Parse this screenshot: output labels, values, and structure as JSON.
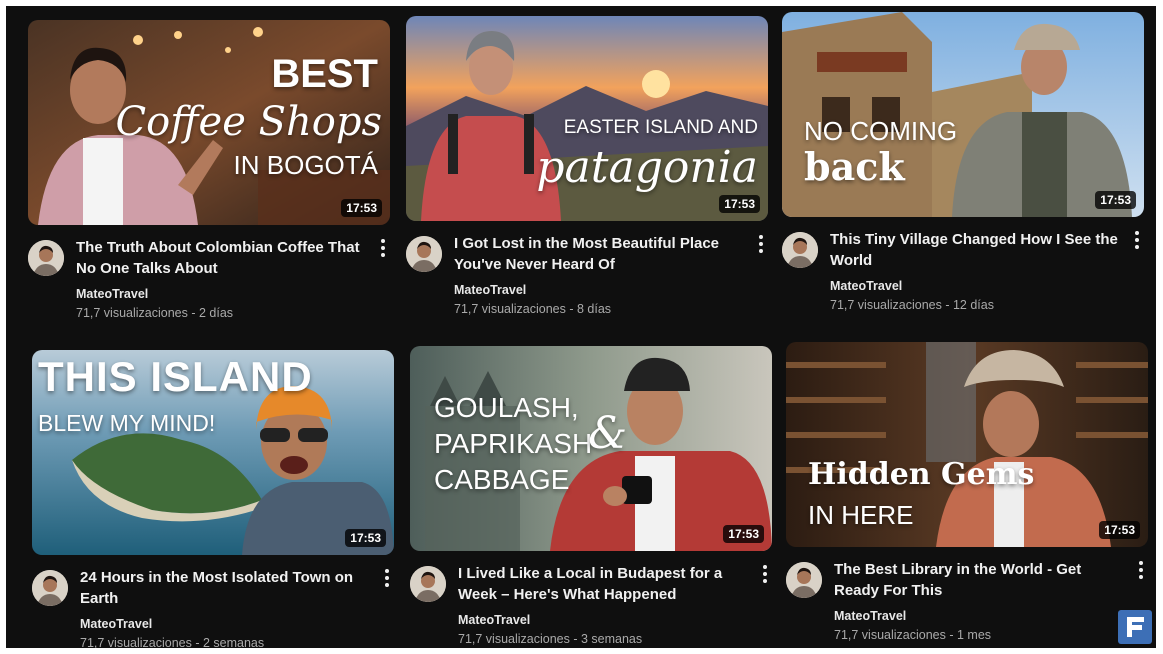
{
  "videos": [
    {
      "title": "The Truth About Colombian Coffee That No One Talks About",
      "channel": "MateoTravel",
      "stats": "71,7 visualizaciones - 2 días",
      "duration": "17:53",
      "thumbnail_text": {
        "line1": "BEST",
        "line2": "Coffee Shops",
        "line3": "IN BOGOTÁ"
      }
    },
    {
      "title": "I Got Lost in the Most Beautiful Place You've Never Heard Of",
      "channel": "MateoTravel",
      "stats": "71,7 visualizaciones - 8 días",
      "duration": "17:53",
      "thumbnail_text": {
        "line1": "EASTER ISLAND AND",
        "line2": "patagonia"
      }
    },
    {
      "title": "This Tiny Village Changed How I See the World",
      "channel": "MateoTravel",
      "stats": "71,7 visualizaciones - 12 días",
      "duration": "17:53",
      "thumbnail_text": {
        "line1": "NO COMING",
        "line2": "back"
      }
    },
    {
      "title": "24 Hours in the Most Isolated Town on Earth",
      "channel": "MateoTravel",
      "stats": "71,7 visualizaciones - 2 semanas",
      "duration": "17:53",
      "thumbnail_text": {
        "line1": "THIS ISLAND",
        "line2": "BLEW MY MIND!"
      }
    },
    {
      "title": "I Lived Like a Local in Budapest for a Week – Here's What Happened",
      "channel": "MateoTravel",
      "stats": "71,7 visualizaciones - 3 semanas",
      "duration": "17:53",
      "thumbnail_text": {
        "line1": "GOULASH,",
        "line2": "PAPRIKASH",
        "line3": "CABBAGE",
        "amp": "&"
      }
    },
    {
      "title": "The Best Library in the World - Get Ready For This",
      "channel": "MateoTravel",
      "stats": "71,7 visualizaciones - 1 mes",
      "duration": "17:53",
      "thumbnail_text": {
        "line1": "Hidden Gems",
        "line2": "IN HERE"
      }
    }
  ],
  "colors": {
    "background": "#0f0f0f",
    "title": "#f1f1f1",
    "secondary": "#aaaaaa",
    "logo": "#3d6fb6"
  },
  "icons": {
    "more": "more-vert-icon",
    "logo": "brand-logo-icon"
  }
}
